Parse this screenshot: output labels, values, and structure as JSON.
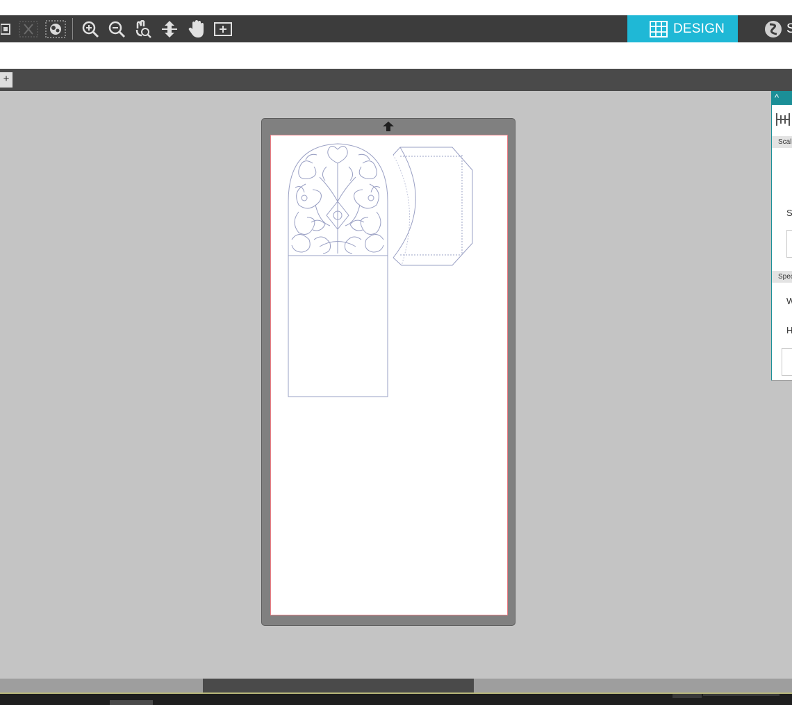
{
  "toolbar": {
    "tools": [
      {
        "icon": "group-icon",
        "interactable": true
      },
      {
        "icon": "ungroup-icon",
        "interactable": true
      },
      {
        "icon": "compound-path-icon",
        "interactable": true
      },
      {
        "icon": "zoom-in-icon",
        "interactable": true
      },
      {
        "icon": "zoom-out-icon",
        "interactable": true
      },
      {
        "icon": "zoom-selection-icon",
        "interactable": true
      },
      {
        "icon": "drag-zoom-icon",
        "interactable": true
      },
      {
        "icon": "pan-hand-icon",
        "interactable": true
      },
      {
        "icon": "fit-to-page-icon",
        "interactable": true
      }
    ],
    "tabs": {
      "design": "DESIGN",
      "send": "SEND"
    }
  },
  "doc_tabs": {
    "add_label": "+"
  },
  "right_panel": {
    "section_scale": "Scale",
    "scale_label": "S",
    "section_specify": "Specify Dimensions",
    "width_label": "W",
    "height_label": "H"
  },
  "colors": {
    "accent": "#1fb8d6",
    "panel_accent": "#1b8f97",
    "toolbar": "#3c3c3c",
    "canvas": "#c4c4c4",
    "mat": "#808080",
    "cut_border": "#ee7f86",
    "design_lines": "#9aa0c4"
  }
}
